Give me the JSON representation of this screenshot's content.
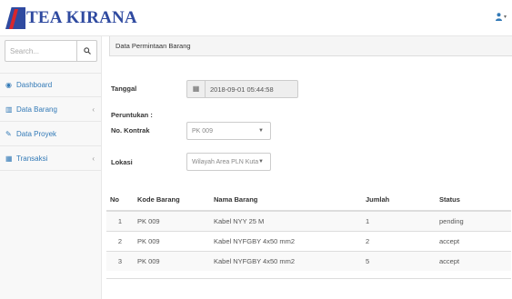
{
  "app": {
    "brand": "TEA KIRANA"
  },
  "header": {
    "user_icon": "user-icon",
    "caret": "▾"
  },
  "sidebar": {
    "search": {
      "placeholder": "Search..."
    },
    "items": [
      {
        "label": "Dashboard",
        "icon": "dashboard-icon",
        "glyph": "◉",
        "has_arrow": false
      },
      {
        "label": "Data Barang",
        "icon": "bar-chart-icon",
        "glyph": "▥",
        "has_arrow": true
      },
      {
        "label": "Data Proyek",
        "icon": "edit-icon",
        "glyph": "✎",
        "has_arrow": false
      },
      {
        "label": "Transaksi",
        "icon": "table-icon",
        "glyph": "▦",
        "has_arrow": true
      }
    ],
    "arrow": "‹"
  },
  "main": {
    "panel_title": "Data Permintaan Barang",
    "form": {
      "tanggal_label": "Tanggal",
      "tanggal_value": "2018-09-01 05:44:58",
      "peruntukan_label": "Peruntukan :",
      "kontrak_label": "No. Kontrak",
      "kontrak_value": "PK 009",
      "lokasi_label": "Lokasi",
      "lokasi_value": "Wilayah Area PLN Kuta"
    },
    "table": {
      "headers": [
        "No",
        "Kode Barang",
        "Nama Barang",
        "Jumlah",
        "Status"
      ],
      "rows": [
        [
          "1",
          "PK 009",
          "Kabel NYY 25 M",
          "1",
          "pending"
        ],
        [
          "2",
          "PK 009",
          "Kabel NYFGBY 4x50 mm2",
          "2",
          "accept"
        ],
        [
          "3",
          "PK 009",
          "Kabel NYFGBY 4x50 mm2",
          "5",
          "accept"
        ]
      ]
    }
  }
}
